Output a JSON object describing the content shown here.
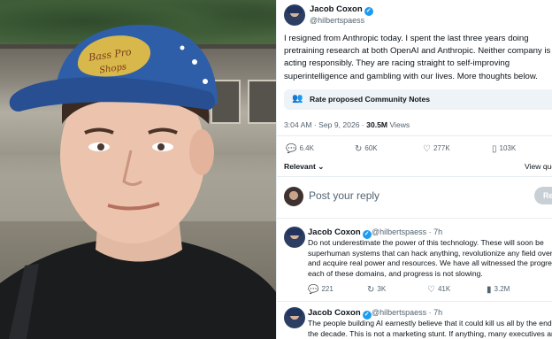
{
  "photo": {
    "cap_text": "Bass Pro Shops"
  },
  "tweet": {
    "author_name": "Jacob Coxon",
    "author_handle": "@hilbertspaess",
    "text_lines": [
      "I resigned from Anthropic today. I spent the last three years doing",
      "pretraining research at both OpenAI and Anthropic. Neither company is",
      "acting responsibly. They are racing straight to self-improving",
      "superintelligence and gambling with our lives. More thoughts below."
    ],
    "community_notes_label": "Rate proposed Community Notes",
    "time": "3:04 AM · Sep 9, 2026 ·",
    "views_count": "30.5M",
    "views_label": "Views",
    "stats": {
      "replies": "6.4K",
      "reposts": "60K",
      "likes": "277K",
      "bookmarks": "103K"
    },
    "sort_label": "Relevant",
    "view_quotes_label": "View quo"
  },
  "reply_box": {
    "placeholder": "Post your reply",
    "button_label": "Re"
  },
  "replies": [
    {
      "name": "Jacob Coxon",
      "handle": "@hilbertspaess · 7h",
      "lines": [
        "Do not underestimate the power of this technology. These will soon be",
        "superhuman systems that can hack anything, revolutionize any field over",
        "and acquire real power and resources. We have all witnessed the progres",
        "each of these domains, and progress is not slowing."
      ],
      "stats": {
        "replies": "221",
        "reposts": "3K",
        "likes": "41K",
        "views": "3.2M"
      }
    },
    {
      "name": "Jacob Coxon",
      "handle": "@hilbertspaess · 7h",
      "lines": [
        "The people building AI earnestly believe that it could kill us all by the end",
        "the decade. This is not a marketing stunt. If anything, many executives are"
      ]
    }
  ],
  "icons": {
    "verified": "verified-badge-icon",
    "notes": "community-notes-icon",
    "reply": "reply-icon",
    "repost": "repost-icon",
    "like": "heart-icon",
    "bookmark": "bookmark-icon",
    "views": "views-chart-icon",
    "chevron": "chevron-down-icon"
  },
  "colors": {
    "accent": "#1d9bf0",
    "text": "#0f1419",
    "muted": "#536471"
  }
}
